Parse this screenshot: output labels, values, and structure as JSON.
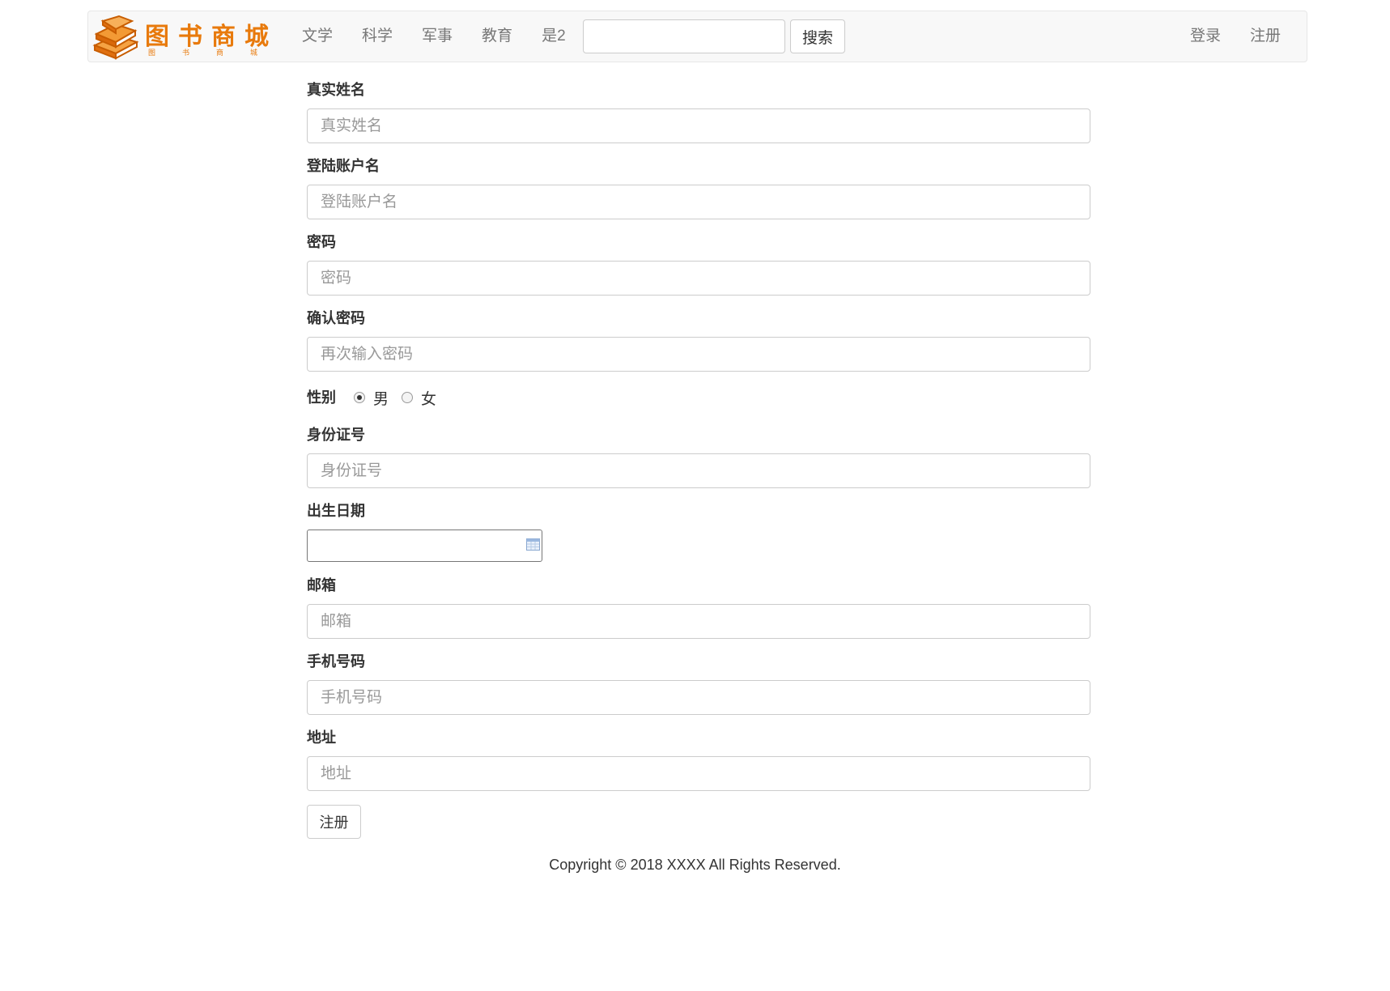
{
  "brand": {
    "logo_icon": "book-stack-icon",
    "title": "图书商城",
    "subtitle": "图书商城",
    "color": "#e87a0c"
  },
  "nav": {
    "links": [
      "文学",
      "科学",
      "军事",
      "教育",
      "是2"
    ],
    "search_value": "",
    "search_button": "搜索",
    "login": "登录",
    "register": "注册"
  },
  "form": {
    "real_name": {
      "label": "真实姓名",
      "placeholder": "真实姓名"
    },
    "username": {
      "label": "登陆账户名",
      "placeholder": "登陆账户名"
    },
    "password": {
      "label": "密码",
      "placeholder": "密码"
    },
    "confirm_password": {
      "label": "确认密码",
      "placeholder": "再次输入密码"
    },
    "gender": {
      "label": "性别",
      "options": [
        "男",
        "女"
      ],
      "selected": "男"
    },
    "id_number": {
      "label": "身份证号",
      "placeholder": "身份证号"
    },
    "birth_date": {
      "label": "出生日期",
      "value": "",
      "icon": "calendar-icon"
    },
    "email": {
      "label": "邮箱",
      "placeholder": "邮箱"
    },
    "phone": {
      "label": "手机号码",
      "placeholder": "手机号码"
    },
    "address": {
      "label": "地址",
      "placeholder": "地址"
    },
    "submit": "注册"
  },
  "footer": {
    "copyright": "Copyright © 2018 XXXX All Rights Reserved."
  }
}
